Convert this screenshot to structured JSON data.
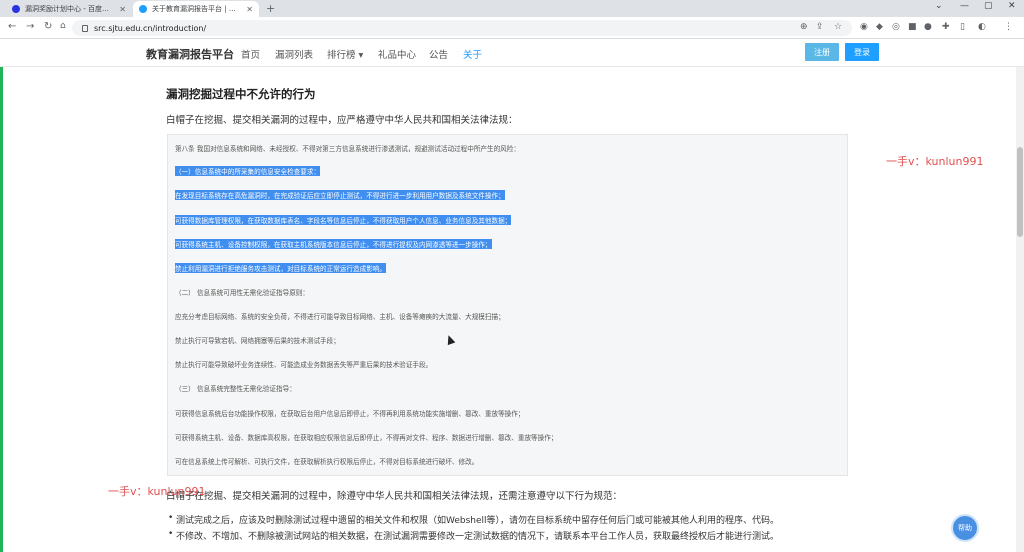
{
  "browser": {
    "tabs": [
      {
        "title": "漏洞奖励计划中心 - 百度搜索",
        "active": false
      },
      {
        "title": "关于教育漏洞报告平台 | 教育漏洞报告平台",
        "active": true
      }
    ],
    "url": "src.sjtu.edu.cn/introduction/"
  },
  "site": {
    "logo": "教育漏洞报告平台",
    "menu": [
      "首页",
      "漏洞列表",
      "排行榜 ▾",
      "礼品中心",
      "公告",
      "关于"
    ],
    "register": "注册",
    "login": "登录"
  },
  "article": {
    "heading": "漏洞挖掘过程中不允许的行为",
    "intro": "白帽子在挖掘、提交相关漏洞的过程中，应严格遵守中华人民共和国相关法律法规：",
    "box_lines": [
      {
        "text": "第八条 我国对信息系统和网络、未经授权、不得对第三方信息系统进行渗透测试，规避测试活动过程中所产生的风险：",
        "hl": false
      },
      {
        "text": "（一）信息系统中的所采集的信息安全检查要求：",
        "hl": true
      },
      {
        "text": "在发现目标系统存在高危漏洞时，在完成验证后应立即停止测试，不得进行进一步利用用户数据及系统文件操作；",
        "hl": true
      },
      {
        "text": "可获得数据库管理权限，在获取数据库表名、字段名等信息后停止，不得获取用户个人信息、业务信息及其他数据；",
        "hl": true
      },
      {
        "text": "可获得系统主机、设备控制权限，在获取主机系统版本信息后停止，不得进行提权及内网渗透等进一步操作；",
        "hl": true
      },
      {
        "text": "禁止利用漏洞进行拒绝服务攻击测试，对目标系统的正常运行造成影响。",
        "hl": true
      },
      {
        "text": "（二） 信息系统可用性无需化验证指导原则：",
        "hl": false
      },
      {
        "text": "应充分考虑目标网络、系统的安全负荷，不得进行可能导致目标网络、主机、设备等瘫痪的大流量、大规模扫描；",
        "hl": false
      },
      {
        "text": "禁止执行可导致宕机、网络拥塞等后果的技术测试手段；",
        "hl": false
      },
      {
        "text": "禁止执行可能导致破坏业务连续性、可能造成业务数据丢失等严重后果的技术验证手段。",
        "hl": false
      },
      {
        "text": "（三） 信息系统完整性无需化验证指导：",
        "hl": false
      },
      {
        "text": "可获得信息系统后台功能操作权限，在获取后台用户信息后即停止，不得再利用系统功能实施增删、篡改、重放等操作；",
        "hl": false
      },
      {
        "text": "可获得系统主机、设备、数据库高权限，在获取相应权限信息后即停止，不得再对文件、程序、数据进行增删、篡改、重放等操作；",
        "hl": false
      },
      {
        "text": "可在信息系统上传可解析、可执行文件，在获取解析执行权限后停止，不得对目标系统进行破坏、修改。",
        "hl": false
      }
    ],
    "after": "白帽子在挖掘、提交相关漏洞的过程中，除遵守中华人民共和国相关法律法规，还需注意遵守以下行为规范：",
    "bullets": [
      "测试完成之后，应该及时删除测试过程中遗留的相关文件和权限（如Webshell等），请勿在目标系统中留存任何后门或可能被其他人利用的程序、代码。",
      "不修改、不增加、不删除被测试网站的相关数据，在测试漏洞需要修改一定测试数据的情况下，请联系本平台工作人员，获取最终授权后才能进行测试。"
    ]
  },
  "watermark": "一手v：kunlun991",
  "float_button": "帮助"
}
